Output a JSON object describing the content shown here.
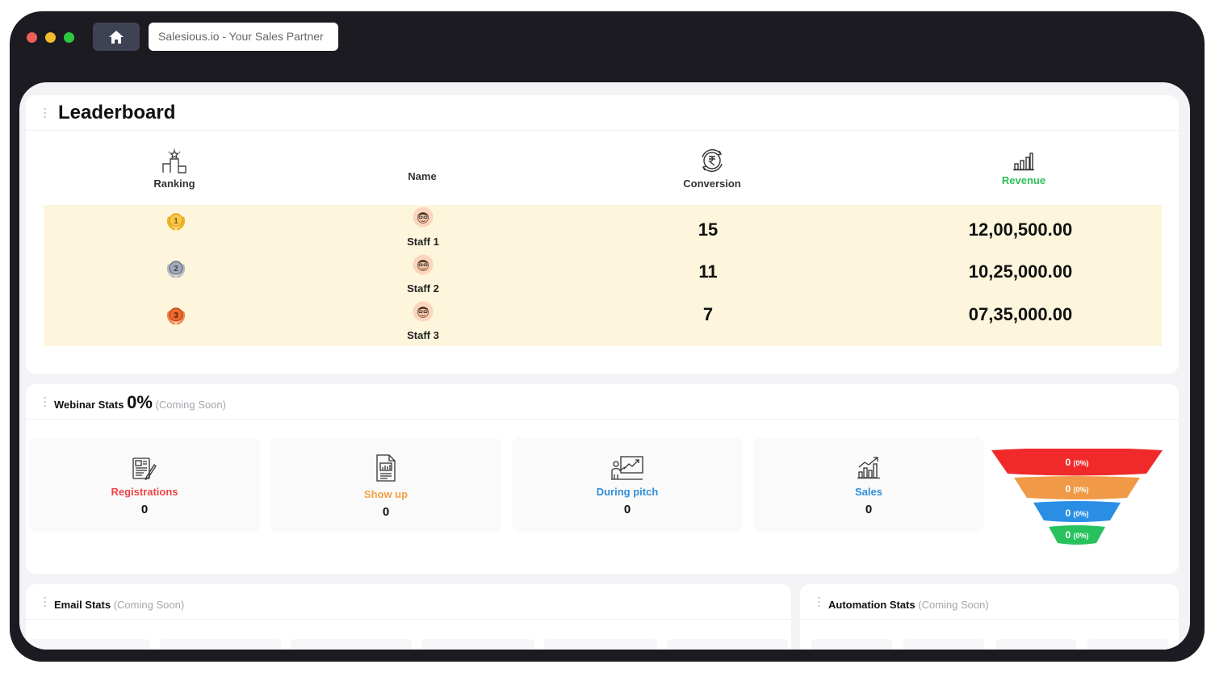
{
  "browser": {
    "url_text": "Salesious.io - Your Sales Partner",
    "home_icon": "home-icon"
  },
  "leaderboard": {
    "title": "Leaderboard",
    "columns": {
      "ranking": "Ranking",
      "name": "Name",
      "conversion": "Conversion",
      "revenue": "Revenue"
    },
    "revenue_color": "#2ebd59",
    "row_highlight_color": "#fdf6dd",
    "rows": [
      {
        "rank": "1",
        "medal_color": "#f1b428",
        "name": "Staff 1",
        "conversion": "15",
        "revenue": "12,00,500.00"
      },
      {
        "rank": "2",
        "medal_color": "#8e96a3",
        "name": "Staff 2",
        "conversion": "11",
        "revenue": "10,25,000.00"
      },
      {
        "rank": "3",
        "medal_color": "#e86a2a",
        "name": "Staff 3",
        "conversion": "7",
        "revenue": "07,35,000.00"
      }
    ]
  },
  "webinar": {
    "title": "Webinar Stats",
    "percent": "0%",
    "coming_soon": "(Coming Soon)",
    "stats": [
      {
        "label": "Registrations",
        "value": "0",
        "color": "#ef4444",
        "icon": "registrations-icon"
      },
      {
        "label": "Show up",
        "value": "0",
        "color": "#f59e42",
        "icon": "document-chart-icon"
      },
      {
        "label": "During pitch",
        "value": "0",
        "color": "#2f8fd6",
        "icon": "presentation-icon"
      },
      {
        "label": "Sales",
        "value": "0",
        "color": "#2f8fd6",
        "icon": "growth-chart-icon"
      }
    ],
    "funnel": [
      {
        "value": "0",
        "pct": "(0%)",
        "color": "#f02a2a"
      },
      {
        "value": "0",
        "pct": "(0%)",
        "color": "#f09a48"
      },
      {
        "value": "0",
        "pct": "(0%)",
        "color": "#2a8fe4"
      },
      {
        "value": "0",
        "pct": "(0%)",
        "color": "#27c25e"
      }
    ]
  },
  "email": {
    "title": "Email Stats",
    "coming_soon": "(Coming Soon)"
  },
  "automation": {
    "title": "Automation Stats",
    "coming_soon": "(Coming Soon)"
  }
}
